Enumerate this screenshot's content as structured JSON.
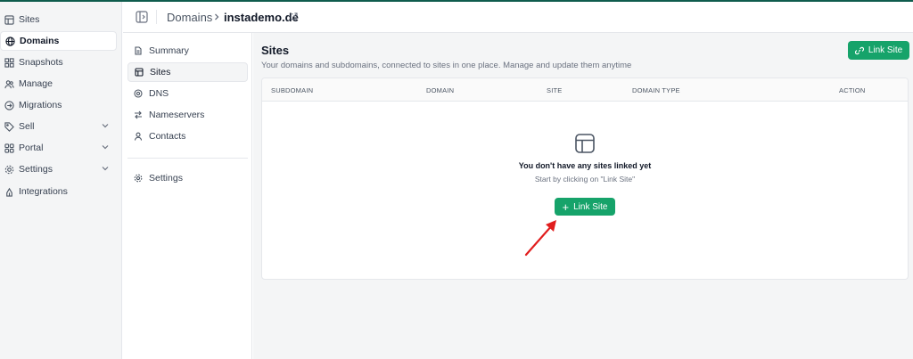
{
  "sidebar": {
    "items": [
      {
        "label": "Sites",
        "icon": "layout-icon"
      },
      {
        "label": "Domains",
        "icon": "globe-icon",
        "active": true
      },
      {
        "label": "Snapshots",
        "icon": "grid-icon"
      },
      {
        "label": "Manage",
        "icon": "users-icon"
      },
      {
        "label": "Migrations",
        "icon": "arrow-circle-icon"
      },
      {
        "label": "Sell",
        "icon": "tag-icon",
        "expandable": true
      },
      {
        "label": "Portal",
        "icon": "portal-icon",
        "expandable": true
      },
      {
        "label": "Settings",
        "icon": "gear-icon",
        "expandable": true
      },
      {
        "label": "Integrations",
        "icon": "plug-icon"
      }
    ]
  },
  "header": {
    "breadcrumb_parent": "Domains",
    "breadcrumb_current": "instademo.de"
  },
  "subnav": {
    "items": [
      {
        "label": "Summary",
        "icon": "file-icon"
      },
      {
        "label": "Sites",
        "icon": "layout-icon",
        "active": true
      },
      {
        "label": "DNS",
        "icon": "dns-icon"
      },
      {
        "label": "Nameservers",
        "icon": "swap-icon"
      },
      {
        "label": "Contacts",
        "icon": "user-icon"
      }
    ],
    "settings_label": "Settings"
  },
  "main": {
    "title": "Sites",
    "subtitle": "Your domains and subdomains, connected to sites in one place. Manage and update them anytime",
    "link_button": "Link Site",
    "columns": [
      "SUBDOMAIN",
      "DOMAIN",
      "SITE",
      "DOMAIN TYPE",
      "ACTION"
    ],
    "empty_title": "You don't have any sites linked yet",
    "empty_sub": "Start by clicking on \"Link Site\"",
    "empty_button": "Link Site"
  },
  "colors": {
    "accent": "#16a36a",
    "arrow": "#e11d1d"
  }
}
